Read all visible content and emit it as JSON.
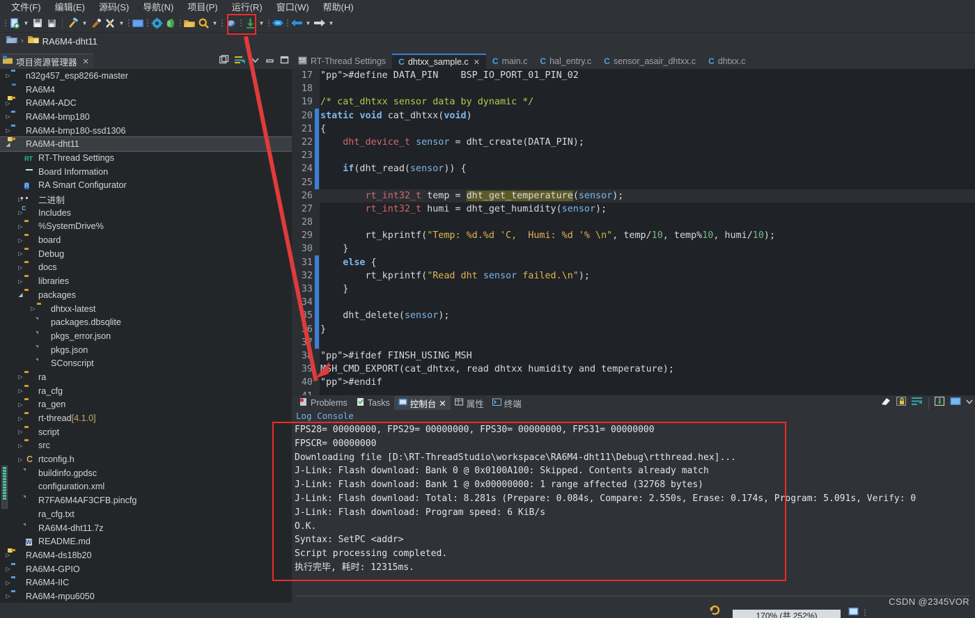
{
  "menu": {
    "items": [
      {
        "label": "文件(F)",
        "name": "menu-file"
      },
      {
        "label": "编辑(E)",
        "name": "menu-edit"
      },
      {
        "label": "源码(S)",
        "name": "menu-source"
      },
      {
        "label": "导航(N)",
        "name": "menu-navigate"
      },
      {
        "label": "项目(P)",
        "name": "menu-project"
      },
      {
        "label": "运行(R)",
        "name": "menu-run"
      },
      {
        "label": "窗口(W)",
        "name": "menu-window"
      },
      {
        "label": "帮助(H)",
        "name": "menu-help"
      }
    ]
  },
  "toolbar": {
    "highlighted_button": "download-flash-button",
    "highlight_color": "#ee2b2b"
  },
  "breadcrumb": {
    "project": "RA6M4-dht11",
    "separator": "›"
  },
  "project_explorer": {
    "title": "项目资源管理器",
    "close": "✕",
    "tree": [
      {
        "indent": 0,
        "arrow": "▷",
        "icon": "project-folder-blue",
        "label": "n32g457_esp8266-master",
        "suffix": ""
      },
      {
        "indent": 0,
        "arrow": "",
        "icon": "folder-blue",
        "label": "RA6M4",
        "suffix": ""
      },
      {
        "indent": 0,
        "arrow": "▷",
        "icon": "project-folder",
        "label": "RA6M4-ADC",
        "suffix": ""
      },
      {
        "indent": 0,
        "arrow": "▷",
        "icon": "project-folder-blue",
        "label": "RA6M4-bmp180",
        "suffix": ""
      },
      {
        "indent": 0,
        "arrow": "▷",
        "icon": "project-folder-blue",
        "label": "RA6M4-bmp180-ssd1306",
        "suffix": ""
      },
      {
        "indent": 0,
        "arrow": "◢",
        "icon": "project-folder",
        "label": "RA6M4-dht11",
        "suffix": "",
        "selected": true
      },
      {
        "indent": 1,
        "arrow": "",
        "icon": "rt-thread",
        "label": "RT-Thread Settings",
        "suffix": ""
      },
      {
        "indent": 1,
        "arrow": "",
        "icon": "board",
        "label": "Board Information",
        "suffix": ""
      },
      {
        "indent": 1,
        "arrow": "",
        "icon": "ra-config",
        "label": "RA Smart Configurator",
        "suffix": ""
      },
      {
        "indent": 1,
        "arrow": "▷",
        "icon": "binary",
        "label": "二进制",
        "suffix": ""
      },
      {
        "indent": 1,
        "arrow": "▷",
        "icon": "includes",
        "label": "Includes",
        "suffix": ""
      },
      {
        "indent": 1,
        "arrow": "▷",
        "icon": "folder",
        "label": "%SystemDrive%",
        "suffix": ""
      },
      {
        "indent": 1,
        "arrow": "▷",
        "icon": "folder",
        "label": "board",
        "suffix": ""
      },
      {
        "indent": 1,
        "arrow": "▷",
        "icon": "folder",
        "label": "Debug",
        "suffix": ""
      },
      {
        "indent": 1,
        "arrow": "▷",
        "icon": "folder",
        "label": "docs",
        "suffix": ""
      },
      {
        "indent": 1,
        "arrow": "▷",
        "icon": "folder",
        "label": "libraries",
        "suffix": ""
      },
      {
        "indent": 1,
        "arrow": "◢",
        "icon": "folder",
        "label": "packages",
        "suffix": ""
      },
      {
        "indent": 2,
        "arrow": "▷",
        "icon": "folder",
        "label": "dhtxx-latest",
        "suffix": ""
      },
      {
        "indent": 2,
        "arrow": "",
        "icon": "file",
        "label": "packages.dbsqlite",
        "suffix": ""
      },
      {
        "indent": 2,
        "arrow": "",
        "icon": "file",
        "label": "pkgs_error.json",
        "suffix": ""
      },
      {
        "indent": 2,
        "arrow": "",
        "icon": "file",
        "label": "pkgs.json",
        "suffix": ""
      },
      {
        "indent": 2,
        "arrow": "",
        "icon": "file",
        "label": "SConscript",
        "suffix": ""
      },
      {
        "indent": 1,
        "arrow": "▷",
        "icon": "folder",
        "label": "ra",
        "suffix": ""
      },
      {
        "indent": 1,
        "arrow": "▷",
        "icon": "folder",
        "label": "ra_cfg",
        "suffix": ""
      },
      {
        "indent": 1,
        "arrow": "▷",
        "icon": "folder",
        "label": "ra_gen",
        "suffix": ""
      },
      {
        "indent": 1,
        "arrow": "▷",
        "icon": "folder",
        "label": "rt-thread",
        "suffix": "[4.1.0]"
      },
      {
        "indent": 1,
        "arrow": "▷",
        "icon": "folder",
        "label": "script",
        "suffix": ""
      },
      {
        "indent": 1,
        "arrow": "▷",
        "icon": "folder",
        "label": "src",
        "suffix": ""
      },
      {
        "indent": 1,
        "arrow": "▷",
        "icon": "c-header",
        "label": "rtconfig.h",
        "suffix": ""
      },
      {
        "indent": 1,
        "arrow": "",
        "icon": "file",
        "label": "buildinfo.gpdsc",
        "suffix": ""
      },
      {
        "indent": 1,
        "arrow": "",
        "icon": "file-yellow",
        "label": "configuration.xml",
        "suffix": ""
      },
      {
        "indent": 1,
        "arrow": "",
        "icon": "file",
        "label": "R7FA6M4AF3CFB.pincfg",
        "suffix": ""
      },
      {
        "indent": 1,
        "arrow": "",
        "icon": "file-yellow",
        "label": "ra_cfg.txt",
        "suffix": ""
      },
      {
        "indent": 1,
        "arrow": "",
        "icon": "file",
        "label": "RA6M4-dht11.7z",
        "suffix": ""
      },
      {
        "indent": 1,
        "arrow": "",
        "icon": "file-word",
        "label": "README.md",
        "suffix": ""
      },
      {
        "indent": 0,
        "arrow": "▷",
        "icon": "project-folder",
        "label": "RA6M4-ds18b20",
        "suffix": ""
      },
      {
        "indent": 0,
        "arrow": "▷",
        "icon": "project-folder-blue",
        "label": "RA6M4-GPIO",
        "suffix": ""
      },
      {
        "indent": 0,
        "arrow": "▷",
        "icon": "project-folder-blue",
        "label": "RA6M4-IIC",
        "suffix": ""
      },
      {
        "indent": 0,
        "arrow": "▷",
        "icon": "project-folder-blue",
        "label": "RA6M4-mpu6050",
        "suffix": ""
      }
    ]
  },
  "editor": {
    "tabs": [
      {
        "label": "RT-Thread Settings",
        "icon": "settings-icon",
        "active": false,
        "closable": false
      },
      {
        "label": "dhtxx_sample.c",
        "icon": "c-file-icon",
        "active": true,
        "closable": true
      },
      {
        "label": "main.c",
        "icon": "c-file-icon",
        "active": false,
        "closable": false
      },
      {
        "label": "hal_entry.c",
        "icon": "c-file-icon",
        "active": false,
        "closable": false
      },
      {
        "label": "sensor_asair_dhtxx.c",
        "icon": "c-file-icon",
        "active": false,
        "closable": false
      },
      {
        "label": "dhtxx.c",
        "icon": "c-file-icon",
        "active": false,
        "closable": false
      }
    ],
    "close_glyph": "✕",
    "first_line_number": 17,
    "lines": [
      {
        "n": 17,
        "text": "#define DATA_PIN    BSP_IO_PORT_01_PIN_02"
      },
      {
        "n": 18,
        "text": ""
      },
      {
        "n": 19,
        "text": "/* cat_dhtxx sensor data by dynamic */"
      },
      {
        "n": 20,
        "text": "static void cat_dhtxx(void)"
      },
      {
        "n": 21,
        "text": "{"
      },
      {
        "n": 22,
        "text": "    dht_device_t sensor = dht_create(DATA_PIN);"
      },
      {
        "n": 23,
        "text": ""
      },
      {
        "n": 24,
        "text": "    if(dht_read(sensor)) {"
      },
      {
        "n": 25,
        "text": ""
      },
      {
        "n": 26,
        "text": "        rt_int32_t temp = dht_get_temperature(sensor);"
      },
      {
        "n": 27,
        "text": "        rt_int32_t humi = dht_get_humidity(sensor);"
      },
      {
        "n": 28,
        "text": ""
      },
      {
        "n": 29,
        "text": "        rt_kprintf(\"Temp: %d.%d 'C,  Humi: %d '% \\n\", temp/10, temp%10, humi/10);"
      },
      {
        "n": 30,
        "text": "    }"
      },
      {
        "n": 31,
        "text": "    else {"
      },
      {
        "n": 32,
        "text": "        rt_kprintf(\"Read dht sensor failed.\\n\");"
      },
      {
        "n": 33,
        "text": "    }"
      },
      {
        "n": 34,
        "text": ""
      },
      {
        "n": 35,
        "text": "    dht_delete(sensor);"
      },
      {
        "n": 36,
        "text": "}"
      },
      {
        "n": 37,
        "text": ""
      },
      {
        "n": 38,
        "text": "#ifdef FINSH_USING_MSH"
      },
      {
        "n": 39,
        "text": "MSH_CMD_EXPORT(cat_dhtxx, read dhtxx humidity and temperature);"
      },
      {
        "n": 40,
        "text": "#endif"
      },
      {
        "n": 41,
        "text": ""
      }
    ],
    "highlighted_line": 26,
    "highlighted_token": "dht_get_temperature"
  },
  "console": {
    "tabs": [
      {
        "label": "Problems",
        "icon": "problems-icon",
        "active": false,
        "closable": false
      },
      {
        "label": "Tasks",
        "icon": "tasks-icon",
        "active": false,
        "closable": false
      },
      {
        "label": "控制台",
        "icon": "console-icon",
        "active": true,
        "closable": true
      },
      {
        "label": "属性",
        "icon": "properties-icon",
        "active": false,
        "closable": false
      },
      {
        "label": "终端",
        "icon": "terminal-icon",
        "active": false,
        "closable": false
      }
    ],
    "close_glyph": "✕",
    "header": "Log Console",
    "lines": [
      "FPS28= 00000000, FPS29= 00000000, FPS30= 00000000, FPS31= 00000000",
      "FPSCR= 00000000",
      "Downloading file [D:\\RT-ThreadStudio\\workspace\\RA6M4-dht11\\Debug\\rtthread.hex]...",
      "J-Link: Flash download: Bank 0 @ 0x0100A100: Skipped. Contents already match",
      "J-Link: Flash download: Bank 1 @ 0x00000000: 1 range affected (32768 bytes)",
      "J-Link: Flash download: Total: 8.281s (Prepare: 0.084s, Compare: 2.550s, Erase: 0.174s, Program: 5.091s, Verify: 0",
      "J-Link: Flash download: Program speed: 6 KiB/s",
      "O.K.",
      "Syntax: SetPC <addr>",
      "Script processing completed.",
      "执行完毕, 耗时: 12315ms."
    ],
    "toolbar_icons": [
      "clear-console-icon",
      "lock-scroll-icon",
      "word-wrap-icon",
      "pin-console-icon",
      "display-selected-console-icon",
      "open-console-dropdown-icon"
    ]
  },
  "statusbar": {
    "zoom_label": "170% (共 252%)",
    "watermark": "CSDN @2345VOR"
  },
  "annotations": {
    "box_toolbar": "red-highlight-toolbar-download",
    "box_console": "red-highlight-console-output",
    "arrow": "red-arrow-from-download-to-endif",
    "color": "#ee2b2b"
  }
}
